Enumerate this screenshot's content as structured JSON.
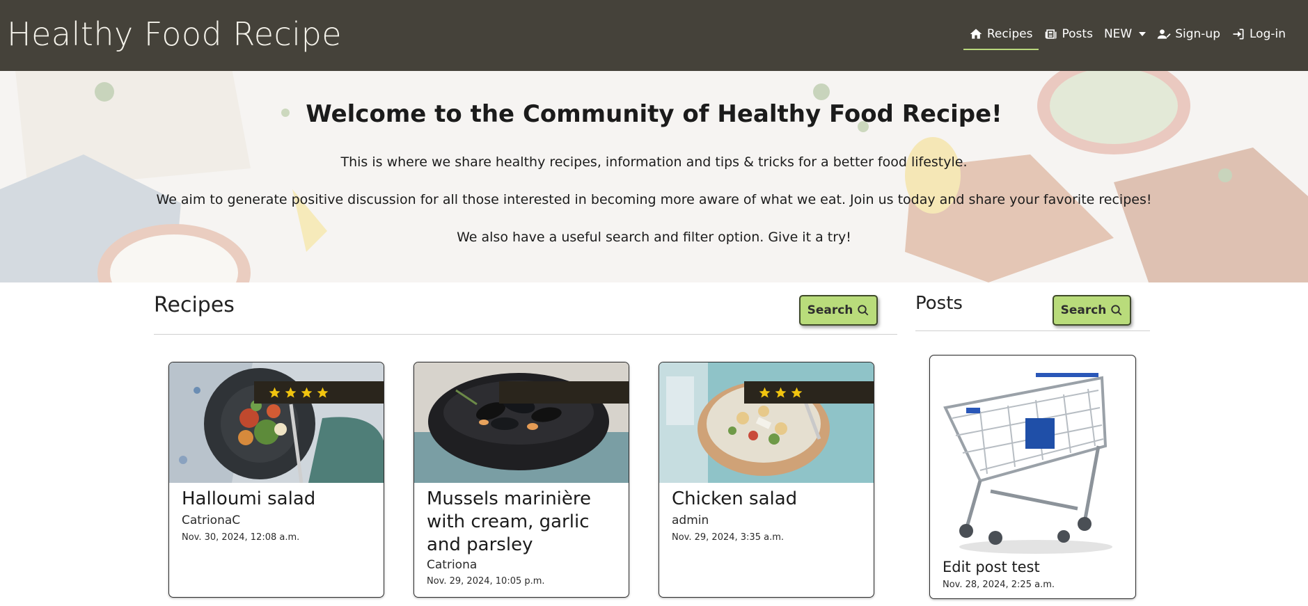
{
  "navbar": {
    "brand": "Healthy Food Recipe",
    "items": [
      {
        "label": "Recipes"
      },
      {
        "label": "Posts"
      },
      {
        "label": "NEW"
      },
      {
        "label": "Sign-up"
      },
      {
        "label": "Log-in"
      }
    ]
  },
  "hero": {
    "title": "Welcome to the Community of Healthy Food Recipe!",
    "line1": "This is where we share healthy recipes, information and tips & tricks for a better food lifestyle.",
    "line2": "We aim to generate positive discussion for all those interested in becoming more aware of what we eat. Join us today and share your favorite recipes!",
    "line3": "We also have a useful search and filter option. Give it a try!"
  },
  "recipes": {
    "heading": "Recipes",
    "search_label": "Search",
    "items": [
      {
        "title": "Halloumi salad",
        "author": "CatrionaC",
        "date": "Nov. 30, 2024, 12:08 a.m.",
        "rating": 4
      },
      {
        "title": "Mussels marinière with cream, garlic and parsley",
        "author": "Catriona",
        "date": "Nov. 29, 2024, 10:05 p.m.",
        "rating": 0
      },
      {
        "title": "Chicken salad",
        "author": "admin",
        "date": "Nov. 29, 2024, 3:35 a.m.",
        "rating": 3
      }
    ]
  },
  "posts": {
    "heading": "Posts",
    "search_label": "Search",
    "items": [
      {
        "title": "Edit post test",
        "date": "Nov. 28, 2024, 2:25 a.m."
      }
    ]
  },
  "colors": {
    "navbar_bg": "#45423a",
    "accent_green": "#b9dc7b",
    "rating_bar": "#2a251c",
    "star": "#f1c40f"
  }
}
